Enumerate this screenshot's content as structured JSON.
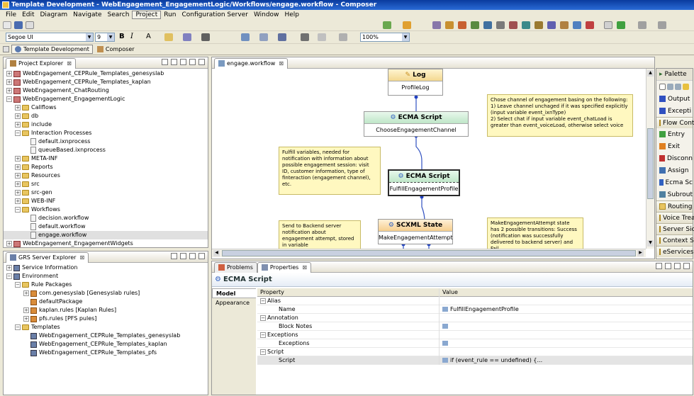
{
  "window": {
    "title": "Template Development - WebEngagement_EngagementLogic/Workflows/engage.workflow - Composer"
  },
  "menu": [
    "File",
    "Edit",
    "Diagram",
    "Navigate",
    "Search",
    "Project",
    "Run",
    "Configuration Server",
    "Window",
    "Help"
  ],
  "toolbar": {
    "font_name": "Segoe UI",
    "font_size": "9",
    "bold": "B",
    "italic": "I",
    "text_color_label": "A",
    "zoom": "100%"
  },
  "perspectives": {
    "template": "Template Development",
    "composer": "Composer"
  },
  "project_explorer": {
    "title": "Project Explorer",
    "items": [
      {
        "label": "WebEngagement_CEPRule_Templates_genesyslab",
        "level": 0,
        "exp": "+",
        "icon": "proj"
      },
      {
        "label": "WebEngagement_CEPRule_Templates_kaplan",
        "level": 0,
        "exp": "+",
        "icon": "proj"
      },
      {
        "label": "WebEngagement_ChatRouting",
        "level": 0,
        "exp": "+",
        "icon": "proj"
      },
      {
        "label": "WebEngagement_EngagementLogic",
        "level": 0,
        "exp": "−",
        "icon": "proj"
      },
      {
        "label": "Callflows",
        "level": 1,
        "exp": "+",
        "icon": "fold"
      },
      {
        "label": "db",
        "level": 1,
        "exp": "+",
        "icon": "fold"
      },
      {
        "label": "include",
        "level": 1,
        "exp": "+",
        "icon": "fold"
      },
      {
        "label": "Interaction Processes",
        "level": 1,
        "exp": "−",
        "icon": "fold"
      },
      {
        "label": "default.ixnprocess",
        "level": 2,
        "exp": "",
        "icon": "file"
      },
      {
        "label": "queueBased.ixnprocess",
        "level": 2,
        "exp": "",
        "icon": "file"
      },
      {
        "label": "META-INF",
        "level": 1,
        "exp": "+",
        "icon": "fold"
      },
      {
        "label": "Reports",
        "level": 1,
        "exp": "+",
        "icon": "fold"
      },
      {
        "label": "Resources",
        "level": 1,
        "exp": "+",
        "icon": "fold"
      },
      {
        "label": "src",
        "level": 1,
        "exp": "+",
        "icon": "fold"
      },
      {
        "label": "src-gen",
        "level": 1,
        "exp": "+",
        "icon": "fold"
      },
      {
        "label": "WEB-INF",
        "level": 1,
        "exp": "+",
        "icon": "fold"
      },
      {
        "label": "Workflows",
        "level": 1,
        "exp": "−",
        "icon": "fold"
      },
      {
        "label": "decision.workflow",
        "level": 2,
        "exp": "",
        "icon": "file"
      },
      {
        "label": "default.workflow",
        "level": 2,
        "exp": "",
        "icon": "file"
      },
      {
        "label": "engage.workflow",
        "level": 2,
        "exp": "",
        "icon": "file",
        "selected": true
      },
      {
        "label": "WebEngagement_EngagementWidgets",
        "level": 0,
        "exp": "+",
        "icon": "proj"
      }
    ]
  },
  "grs_explorer": {
    "title": "GRS Server Explorer",
    "items": [
      {
        "label": "Service Information",
        "level": 0,
        "exp": "+",
        "icon": "srv"
      },
      {
        "label": "Environment",
        "level": 0,
        "exp": "−",
        "icon": "srv"
      },
      {
        "label": "Rule Packages",
        "level": 1,
        "exp": "−",
        "icon": "fold"
      },
      {
        "label": "com.genesyslab [Genesyslab rules]",
        "level": 2,
        "exp": "+",
        "icon": "pkg"
      },
      {
        "label": "defaultPackage",
        "level": 2,
        "exp": "",
        "icon": "pkg"
      },
      {
        "label": "kaplan.rules [Kaplan Rules]",
        "level": 2,
        "exp": "+",
        "icon": "pkg"
      },
      {
        "label": "pfs.rules [PFS pules]",
        "level": 2,
        "exp": "+",
        "icon": "pkg"
      },
      {
        "label": "Templates",
        "level": 1,
        "exp": "−",
        "icon": "fold"
      },
      {
        "label": "WebEngagement_CEPRule_Templates_genesyslab",
        "level": 2,
        "exp": "",
        "icon": "srv"
      },
      {
        "label": "WebEngagement_CEPRule_Templates_kaplan",
        "level": 2,
        "exp": "",
        "icon": "srv"
      },
      {
        "label": "WebEngagement_CEPRule_Templates_pfs",
        "level": 2,
        "exp": "",
        "icon": "srv"
      }
    ]
  },
  "editor": {
    "tab": "engage.workflow",
    "nodes": {
      "log": {
        "head": "Log",
        "body": "ProfileLog"
      },
      "ecma1": {
        "head": "ECMA Script",
        "body": "ChooseEngagementChannel"
      },
      "ecma2": {
        "head": "ECMA Script",
        "body": "FulfillEngagementProfile"
      },
      "scxml": {
        "head": "SCXML State",
        "body": "MakeEngagementAttempt"
      }
    },
    "notes": {
      "n1": "Chose channel of engagement basing on the following:\n1) Leave channel unchaged if it was specified explicitly (input variable event_ixnType)\n2) Select chat if input variable event_chatLoad is greater than event_voiceLoad, otherwise select voice",
      "n2": "Fulfill variables, needed for notification with information about possible engagement session: visit ID, customer information, type of finteraction (engagement channel), etc.",
      "n3": "Send to  Backend server notification about engagement attempt, stored in variable",
      "n4": "MakeEngagementAttempt state has 2 possible transitions: Success (notification was successfully delivered to backend server) and Fail"
    }
  },
  "palette": {
    "title": "Palette",
    "items": [
      {
        "kind": "item",
        "label": "Output",
        "icon": "arrow"
      },
      {
        "kind": "item",
        "label": "Excepti",
        "icon": "arrow"
      },
      {
        "kind": "cat",
        "label": "Flow Contr"
      },
      {
        "kind": "item",
        "label": "Entry",
        "icon": "entry"
      },
      {
        "kind": "item",
        "label": "Exit",
        "icon": "exit"
      },
      {
        "kind": "item",
        "label": "Disconn",
        "icon": "disc"
      },
      {
        "kind": "item",
        "label": "Assign",
        "icon": "assign"
      },
      {
        "kind": "item",
        "label": "Ecma Sc",
        "icon": "ecma"
      },
      {
        "kind": "item",
        "label": "Subrout",
        "icon": "sub"
      },
      {
        "kind": "cat",
        "label": "Routing"
      },
      {
        "kind": "cat",
        "label": "Voice Trea"
      },
      {
        "kind": "cat",
        "label": "Server Side"
      },
      {
        "kind": "cat",
        "label": "Context Se"
      },
      {
        "kind": "cat",
        "label": "eServices"
      }
    ]
  },
  "bottom": {
    "tabs": {
      "problems": "Problems",
      "properties": "Properties"
    },
    "section_title": "ECMA Script",
    "side_tabs": {
      "model": "Model",
      "appearance": "Appearance"
    },
    "headers": {
      "property": "Property",
      "value": "Value"
    },
    "rows": [
      {
        "name": "Alias",
        "group": true,
        "value": ""
      },
      {
        "name": "Name",
        "group": false,
        "value": "FulfillEngagementProfile",
        "hasicon": true
      },
      {
        "name": "Annotation",
        "group": true,
        "value": ""
      },
      {
        "name": "Block Notes",
        "group": false,
        "value": "",
        "hasicon": true
      },
      {
        "name": "Exceptions",
        "group": true,
        "value": ""
      },
      {
        "name": "Exceptions",
        "group": false,
        "value": "",
        "hasicon": true
      },
      {
        "name": "Script",
        "group": true,
        "value": ""
      },
      {
        "name": "Script",
        "group": false,
        "value": "if (event_rule == undefined) {...",
        "hasicon": true,
        "highlight": true
      }
    ]
  }
}
